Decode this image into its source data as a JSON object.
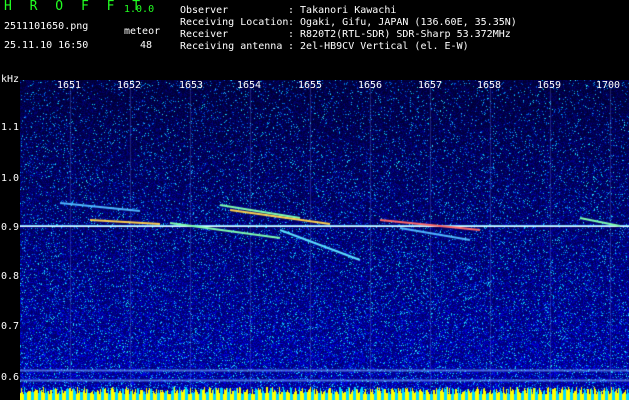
{
  "header": {
    "app_title": "H R O F F T",
    "app_version": "1.0.0",
    "file_name": "2511101650.png",
    "date_time": "25.11.10 16:50",
    "meteor_label": "meteor",
    "meteor_count": "48"
  },
  "info": [
    {
      "label": "Observer",
      "value": ": Takanori Kawachi"
    },
    {
      "label": "Receiving Location",
      "value": ": Ogaki, Gifu, JAPAN (136.60E, 35.35N)"
    },
    {
      "label": "Receiver",
      "value": ": R820T2(RTL-SDR) SDR-Sharp 53.372MHz"
    },
    {
      "label": "Receiving antenna",
      "value": ": 2el-HB9CV Vertical (el. E-W)"
    }
  ],
  "axes": {
    "y_unit": "kHz",
    "y_ticks": [
      "1.1",
      "1.0",
      "0.9",
      "0.8",
      "0.7",
      "0.6"
    ],
    "x_ticks": [
      "1651",
      "1652",
      "1653",
      "1654",
      "1655",
      "1656",
      "1657",
      "1658",
      "1659",
      "1700"
    ]
  },
  "colors": {
    "text": "#ffffff",
    "title_green": "#22ff22",
    "background": "#000000",
    "carrier": "#7fd9ff",
    "baseline_yellow": "#ffff00",
    "baseline_cyan": "#00d8ff"
  }
}
